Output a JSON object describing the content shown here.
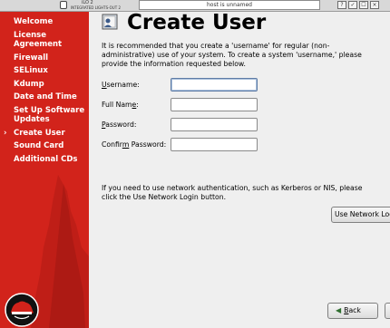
{
  "topbar": {
    "ilo_title": "iLO 2",
    "ilo_subtitle": "INTEGRATED LIGHTS-OUT 2",
    "host_status": "host is unnamed",
    "controls": [
      "?",
      "✓",
      "☐",
      "×"
    ]
  },
  "sidebar": {
    "items": [
      {
        "label": "Welcome",
        "current": false
      },
      {
        "label": "License Agreement",
        "current": false
      },
      {
        "label": "Firewall",
        "current": false
      },
      {
        "label": "SELinux",
        "current": false
      },
      {
        "label": "Kdump",
        "current": false
      },
      {
        "label": "Date and Time",
        "current": false
      },
      {
        "label": "Set Up Software Updates",
        "current": false
      },
      {
        "label": "Create User",
        "current": true
      },
      {
        "label": "Sound Card",
        "current": false
      },
      {
        "label": "Additional CDs",
        "current": false
      }
    ]
  },
  "main": {
    "title": "Create User",
    "intro": "It is recommended that you create a 'username' for regular (non-administrative) use of your system. To create a system 'username,' please provide the information requested below.",
    "fields": {
      "username": {
        "label_pre": "",
        "label_mn": "U",
        "label_post": "sername:",
        "value": ""
      },
      "fullname": {
        "label_pre": "Full Nam",
        "label_mn": "e",
        "label_post": ":",
        "value": ""
      },
      "password": {
        "label_pre": "",
        "label_mn": "P",
        "label_post": "assword:",
        "value": ""
      },
      "confirm": {
        "label_pre": "Confir",
        "label_mn": "m",
        "label_post": " Password:",
        "value": ""
      }
    },
    "network_note": "If you need to use network authentication, such as Kerberos or NIS, please click the Use Network Login button.",
    "network_button": "Use Network Login",
    "back_button_mn": "B",
    "back_button_rest": "ack"
  },
  "colors": {
    "sidebar_red": "#d2231b",
    "background": "#efefef"
  }
}
